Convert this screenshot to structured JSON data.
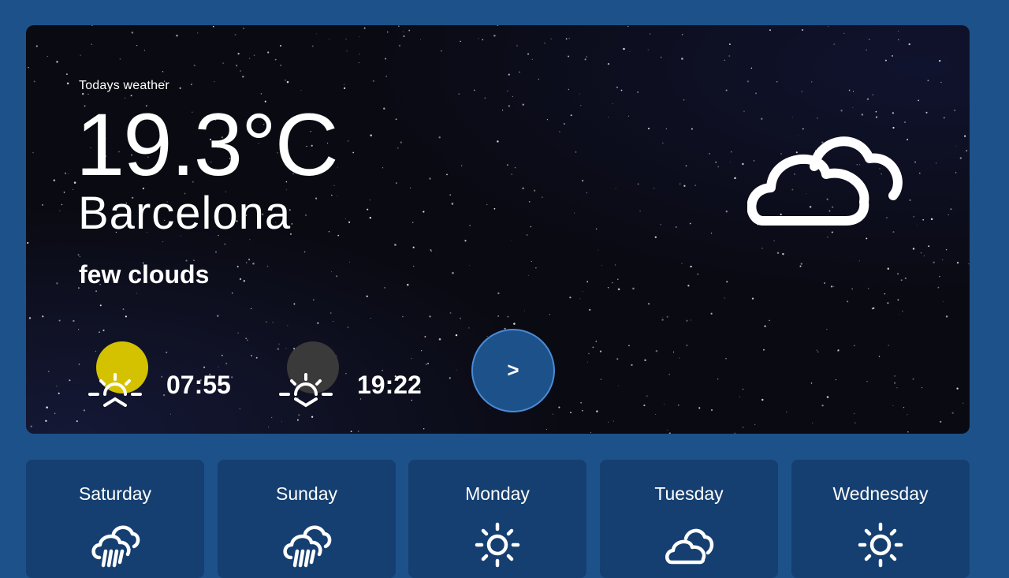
{
  "hero": {
    "subtitle": "Todays weather",
    "temperature": "19.3°C",
    "city": "Barcelona",
    "description": "few clouds",
    "condition_icon": "clouds-icon",
    "sunrise": {
      "time": "07:55",
      "icon": "sunrise-icon",
      "disc_color": "#d4c200"
    },
    "sunset": {
      "time": "19:22",
      "icon": "sunset-icon",
      "disc_color": "#3a3a3a"
    },
    "next_label": ">"
  },
  "forecast": [
    {
      "day": "Saturday",
      "icon": "rain-cloud-icon"
    },
    {
      "day": "Sunday",
      "icon": "rain-cloud-icon"
    },
    {
      "day": "Monday",
      "icon": "sun-icon"
    },
    {
      "day": "Tuesday",
      "icon": "clouds-icon"
    },
    {
      "day": "Wednesday",
      "icon": "sun-icon"
    }
  ],
  "colors": {
    "background": "#1d5189",
    "card": "#153f70",
    "hero": "#0a0a12",
    "button_border": "#4a8bd8"
  }
}
